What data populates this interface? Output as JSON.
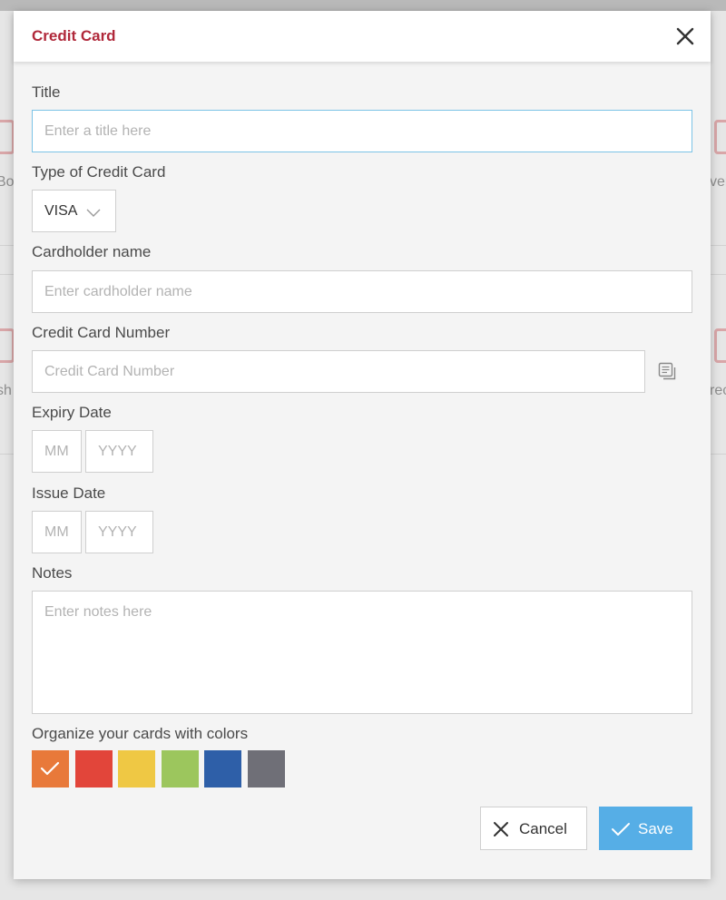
{
  "background": {
    "left_texts": [
      "Bo",
      "sh"
    ],
    "right_texts": [
      "ver",
      "rec"
    ]
  },
  "modal": {
    "title": "Credit Card",
    "close_icon": "close-icon"
  },
  "form": {
    "title": {
      "label": "Title",
      "placeholder": "Enter a title here",
      "value": ""
    },
    "card_type": {
      "label": "Type of Credit Card",
      "selected": "VISA"
    },
    "cardholder": {
      "label": "Cardholder name",
      "placeholder": "Enter cardholder name",
      "value": ""
    },
    "card_number": {
      "label": "Credit Card Number",
      "placeholder": "Credit Card Number",
      "value": "",
      "copy_icon": "copy-icon"
    },
    "expiry": {
      "label": "Expiry Date",
      "month_placeholder": "MM",
      "year_placeholder": "YYYY"
    },
    "issue": {
      "label": "Issue Date",
      "month_placeholder": "MM",
      "year_placeholder": "YYYY"
    },
    "notes": {
      "label": "Notes",
      "placeholder": "Enter notes here",
      "value": ""
    },
    "colors": {
      "label": "Organize your cards with colors",
      "swatches": [
        {
          "name": "orange",
          "hex": "#e8793a",
          "selected": true
        },
        {
          "name": "red",
          "hex": "#e2453a",
          "selected": false
        },
        {
          "name": "yellow",
          "hex": "#efc844",
          "selected": false
        },
        {
          "name": "green",
          "hex": "#9cc65d",
          "selected": false
        },
        {
          "name": "blue",
          "hex": "#2e5fa8",
          "selected": false
        },
        {
          "name": "gray",
          "hex": "#6f6f77",
          "selected": false
        }
      ]
    }
  },
  "actions": {
    "cancel_label": "Cancel",
    "save_label": "Save"
  },
  "colors": {
    "accent_title": "#b0283a",
    "save_button": "#56aee6",
    "focus_border": "#7cc3e6"
  }
}
